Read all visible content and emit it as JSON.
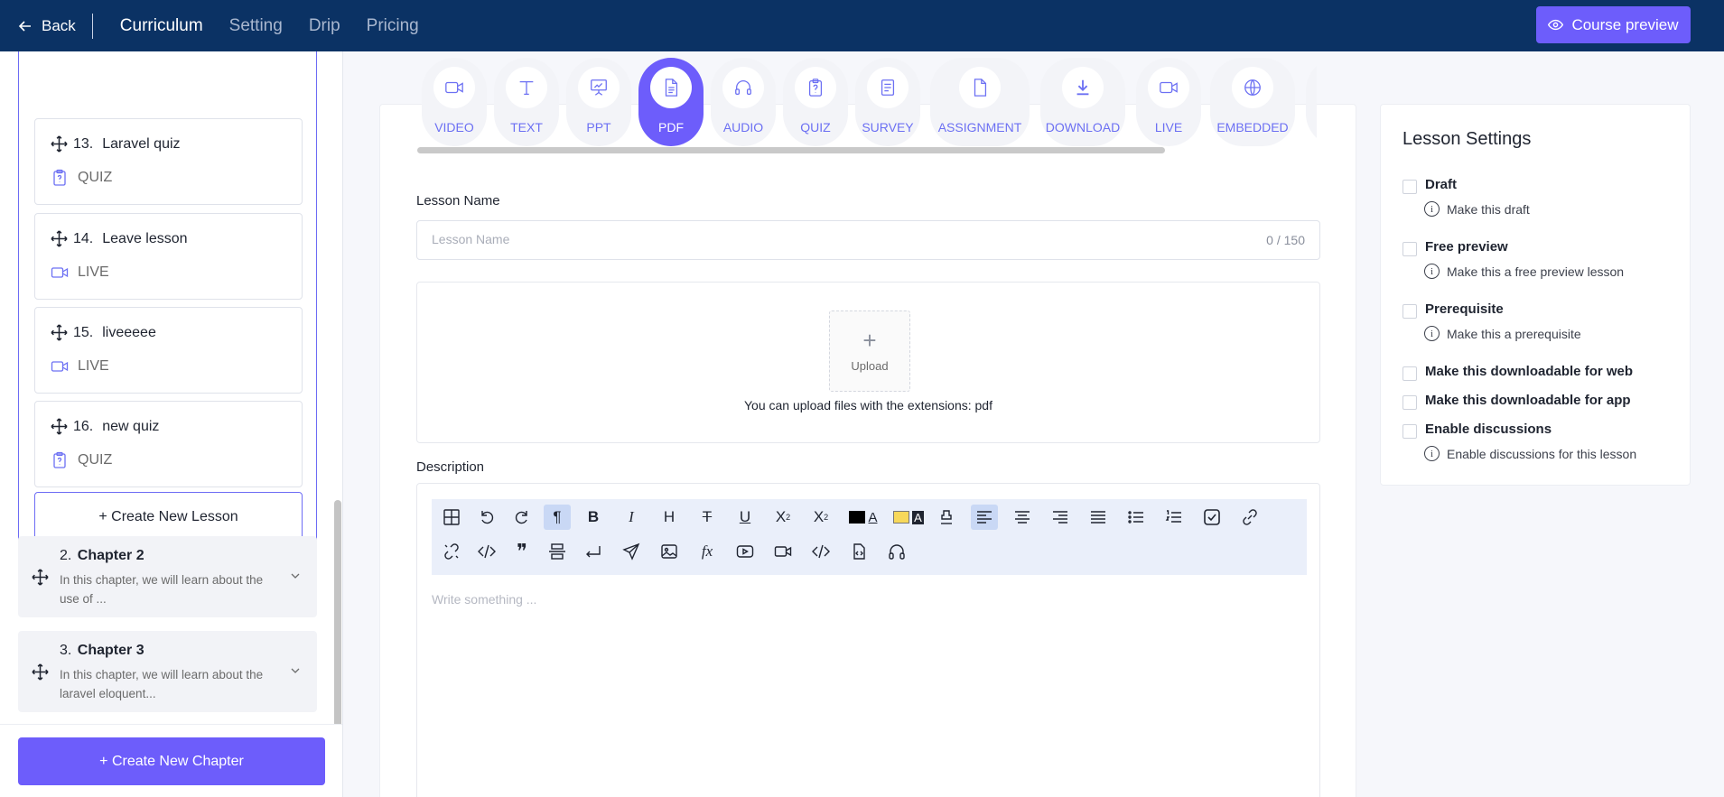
{
  "topbar": {
    "back_label": "Back",
    "tabs": [
      {
        "label": "Curriculum",
        "active": true
      },
      {
        "label": "Setting",
        "active": false
      },
      {
        "label": "Drip",
        "active": false
      },
      {
        "label": "Pricing",
        "active": false
      }
    ],
    "preview_label": "Course preview"
  },
  "sidebar": {
    "lessons": [
      {
        "number": "13.",
        "title": "Laravel quiz",
        "type": "QUIZ",
        "icon": "quiz-icon"
      },
      {
        "number": "14.",
        "title": "Leave lesson",
        "type": "LIVE",
        "icon": "video-icon"
      },
      {
        "number": "15.",
        "title": "liveeeee",
        "type": "LIVE",
        "icon": "video-icon"
      },
      {
        "number": "16.",
        "title": "new quiz",
        "type": "QUIZ",
        "icon": "quiz-icon"
      }
    ],
    "create_lesson_label": "+ Create New Lesson",
    "chapters": [
      {
        "number": "2.",
        "title": "Chapter 2",
        "description": "In this chapter, we will learn about the use of ..."
      },
      {
        "number": "3.",
        "title": "Chapter 3",
        "description": "In this chapter, we will learn about the laravel eloquent..."
      }
    ],
    "create_chapter_label": "+ Create New Chapter"
  },
  "lesson_types": [
    {
      "label": "VIDEO",
      "icon": "video-icon",
      "active": false
    },
    {
      "label": "TEXT",
      "icon": "text-icon",
      "active": false
    },
    {
      "label": "PPT",
      "icon": "presentation-icon",
      "active": false
    },
    {
      "label": "PDF",
      "icon": "document-icon",
      "active": true
    },
    {
      "label": "AUDIO",
      "icon": "headphones-icon",
      "active": false
    },
    {
      "label": "QUIZ",
      "icon": "quiz-icon",
      "active": false
    },
    {
      "label": "SURVEY",
      "icon": "survey-icon",
      "active": false
    },
    {
      "label": "ASSIGNMENT",
      "icon": "file-icon",
      "active": false
    },
    {
      "label": "DOWNLOAD",
      "icon": "download-icon",
      "active": false
    },
    {
      "label": "LIVE",
      "icon": "video-icon",
      "active": false
    },
    {
      "label": "EMBEDDED",
      "icon": "globe-icon",
      "active": false
    }
  ],
  "form": {
    "lesson_name_label": "Lesson Name",
    "lesson_name_placeholder": "Lesson Name",
    "lesson_name_value": "",
    "lesson_name_counter": "0 / 150",
    "upload_label": "Upload",
    "upload_hint": "You can upload files with the extensions: pdf",
    "description_label": "Description",
    "editor_placeholder": "Write something ..."
  },
  "settings": {
    "title": "Lesson Settings",
    "options": [
      {
        "title": "Draft",
        "description": "Make this draft",
        "checked": false
      },
      {
        "title": "Free preview",
        "description": "Make this a free preview lesson",
        "checked": false
      },
      {
        "title": "Prerequisite",
        "description": "Make this a prerequisite",
        "checked": false
      },
      {
        "title": "Make this downloadable for web",
        "description": "",
        "checked": false
      },
      {
        "title": "Make this downloadable for app",
        "description": "",
        "checked": false
      },
      {
        "title": "Enable discussions",
        "description": "Enable discussions for this lesson",
        "checked": false
      }
    ]
  },
  "colors": {
    "topbar": "#0b3264",
    "accent": "#6d5dfb",
    "type_label": "#6c70f3"
  }
}
